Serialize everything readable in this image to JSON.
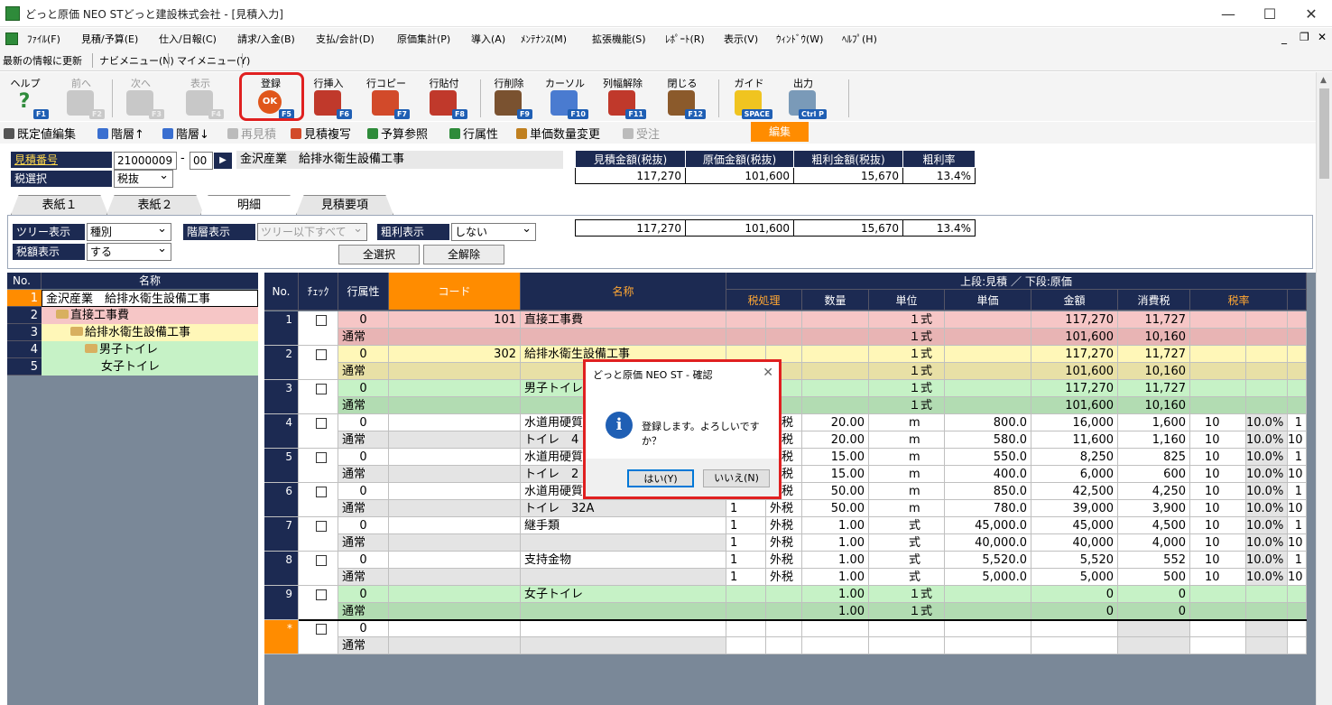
{
  "window": {
    "title": "どっと原価 NEO STどっと建設株式会社 - [見積入力]"
  },
  "menu": [
    "ﾌｧｲﾙ(F)",
    "見積/予算(E)",
    "仕入/日報(C)",
    "請求/入金(B)",
    "支払/会計(D)",
    "原価集計(P)",
    "導入(A)",
    "ﾒﾝﾃﾅﾝｽ(M)",
    "拡張機能(S)",
    "ﾚﾎﾟｰﾄ(R)",
    "表示(V)",
    "ｳｨﾝﾄﾞｳ(W)",
    "ﾍﾙﾌﾟ(H)"
  ],
  "quick": [
    "最新の情報に更新",
    "ナビメニュー(N)",
    "マイメニュー(Y)"
  ],
  "toolbar": [
    {
      "label": "ヘルプ",
      "key": "F1"
    },
    {
      "label": "前へ",
      "key": "F2"
    },
    {
      "label": "次へ",
      "key": "F3"
    },
    {
      "label": "表示",
      "key": "F4"
    },
    {
      "label": "登録",
      "key": "F5"
    },
    {
      "label": "行挿入",
      "key": "F6"
    },
    {
      "label": "行コピー",
      "key": "F7"
    },
    {
      "label": "行貼付",
      "key": "F8"
    },
    {
      "label": "行削除",
      "key": "F9"
    },
    {
      "label": "カーソル",
      "key": "F10"
    },
    {
      "label": "列幅解除",
      "key": "F11"
    },
    {
      "label": "閉じる",
      "key": "F12"
    },
    {
      "label": "ガイド",
      "key": "SPACE"
    },
    {
      "label": "出力",
      "key": "Ctrl P"
    }
  ],
  "subtools": [
    "既定値編集",
    "階層↑",
    "階層↓",
    "再見積",
    "見積複写",
    "予算参照",
    "行属性",
    "単価数量変更",
    "受注"
  ],
  "edit_label": "編集",
  "header": {
    "estimate_no_label": "見積番号",
    "estimate_no": "21000009",
    "estimate_sub": "00",
    "estimate_name": "金沢産業　給排水衛生設備工事",
    "tax_label": "税選択",
    "tax_value": "税抜"
  },
  "summary": {
    "headers": [
      "見積金額(税抜)",
      "原価金額(税抜)",
      "粗利金額(税抜)",
      "粗利率"
    ],
    "values": [
      "117,270",
      "101,600",
      "15,670",
      "13.4%"
    ],
    "values2": [
      "117,270",
      "101,600",
      "15,670",
      "13.4%"
    ]
  },
  "tabs": [
    "表紙１",
    "表紙２",
    "明細",
    "見積要項"
  ],
  "filters": {
    "tree_label": "ツリー表示",
    "tree_value": "種別",
    "tax_label": "税額表示",
    "tax_value": "する",
    "level_label": "階層表示",
    "level_value": "ツリー以下すべて",
    "profit_label": "粗利表示",
    "profit_value": "しない",
    "select_all": "全選択",
    "deselect_all": "全解除"
  },
  "tree": {
    "header_no": "No.",
    "header_name": "名称",
    "rows": [
      {
        "no": "1",
        "name": "金沢産業　給排水衛生設備工事",
        "bg": "#ffffff"
      },
      {
        "no": "2",
        "name": "直接工事費",
        "bg": "#f6c6c6"
      },
      {
        "no": "3",
        "name": "給排水衛生設備工事",
        "bg": "#fff7b8"
      },
      {
        "no": "4",
        "name": "男子トイレ",
        "bg": "#c6f2c6"
      },
      {
        "no": "5",
        "name": "女子トイレ",
        "bg": "#c6f2c6"
      }
    ]
  },
  "grid": {
    "headers": {
      "no": "No.",
      "check": "ﾁｪｯｸ",
      "attr": "行属性",
      "code": "コード",
      "name": "名称",
      "top": "上段:見積 ／ 下段:原価",
      "taxproc": "税処理",
      "qty": "数量",
      "unit": "単位",
      "price": "単価",
      "amount": "金額",
      "tax": "消費税",
      "taxrate": "税率"
    },
    "rows": [
      {
        "no": "1",
        "attr": "0",
        "type": "通常",
        "code": "101",
        "n1": "直接工事費",
        "n2": "",
        "tp1": "",
        "tp2": "",
        "tp3": "",
        "tp4": "",
        "q1": "",
        "q2": "",
        "u1": "１式",
        "u2": "１式",
        "p1": "",
        "p2": "",
        "a1": "117,270",
        "a2": "101,600",
        "t1": "11,727",
        "t2": "10,160",
        "r1": "",
        "r2": "",
        "rr1": "",
        "rr2": "",
        "x1": "",
        "x2": "",
        "bg": "#f6c6c6",
        "bg2": "#e8b4b4"
      },
      {
        "no": "2",
        "attr": "0",
        "type": "通常",
        "code": "302",
        "n1": "給排水衛生設備工事",
        "n2": "",
        "tp1": "",
        "tp2": "",
        "tp3": "",
        "tp4": "",
        "q1": "",
        "q2": "",
        "u1": "１式",
        "u2": "１式",
        "p1": "",
        "p2": "",
        "a1": "117,270",
        "a2": "101,600",
        "t1": "11,727",
        "t2": "10,160",
        "r1": "",
        "r2": "",
        "rr1": "",
        "rr2": "",
        "x1": "",
        "x2": "",
        "bg": "#fff7b8",
        "bg2": "#e8e0a6"
      },
      {
        "no": "3",
        "attr": "0",
        "type": "通常",
        "code": "",
        "n1": "男子トイレ",
        "n2": "",
        "tp1": "",
        "tp2": "",
        "tp3": "",
        "tp4": "",
        "q1": "",
        "q2": "",
        "u1": "１式",
        "u2": "１式",
        "p1": "",
        "p2": "",
        "a1": "117,270",
        "a2": "101,600",
        "t1": "11,727",
        "t2": "10,160",
        "r1": "",
        "r2": "",
        "rr1": "",
        "rr2": "",
        "x1": "",
        "x2": "",
        "bg": "#c6f2c6",
        "bg2": "#b2dcb2"
      },
      {
        "no": "4",
        "attr": "0",
        "type": "通常",
        "code": "",
        "n1": "水道用硬質",
        "n2": "トイレ　4",
        "tp1": "1",
        "tp2": "外税",
        "tp3": "1",
        "tp4": "外税",
        "q1": "20.00",
        "q2": "20.00",
        "u1": "m",
        "u2": "m",
        "p1": "800.0",
        "p2": "580.0",
        "a1": "16,000",
        "a2": "11,600",
        "t1": "1,600",
        "t2": "1,160",
        "r1": "10",
        "r2": "10",
        "rr1": "10.0%",
        "rr2": "10.0%",
        "x1": "1",
        "x2": "10",
        "bg": "#ffffff",
        "bg2": "#ffffff"
      },
      {
        "no": "5",
        "attr": "0",
        "type": "通常",
        "code": "",
        "n1": "水道用硬質",
        "n2": "トイレ　2",
        "tp1": "1",
        "tp2": "外税",
        "tp3": "1",
        "tp4": "外税",
        "q1": "15.00",
        "q2": "15.00",
        "u1": "m",
        "u2": "m",
        "p1": "550.0",
        "p2": "400.0",
        "a1": "8,250",
        "a2": "6,000",
        "t1": "825",
        "t2": "600",
        "r1": "10",
        "r2": "10",
        "rr1": "10.0%",
        "rr2": "10.0%",
        "x1": "1",
        "x2": "10",
        "bg": "#ffffff",
        "bg2": "#ffffff"
      },
      {
        "no": "6",
        "attr": "0",
        "type": "通常",
        "code": "",
        "n1": "水道用硬質",
        "n2": "トイレ　32A",
        "tp1": "1",
        "tp2": "外税",
        "tp3": "1",
        "tp4": "外税",
        "q1": "50.00",
        "q2": "50.00",
        "u1": "m",
        "u2": "m",
        "p1": "850.0",
        "p2": "780.0",
        "a1": "42,500",
        "a2": "39,000",
        "t1": "4,250",
        "t2": "3,900",
        "r1": "10",
        "r2": "10",
        "rr1": "10.0%",
        "rr2": "10.0%",
        "x1": "1",
        "x2": "10",
        "bg": "#ffffff",
        "bg2": "#ffffff"
      },
      {
        "no": "7",
        "attr": "0",
        "type": "通常",
        "code": "",
        "n1": "継手類",
        "n2": "",
        "tp1": "1",
        "tp2": "外税",
        "tp3": "1",
        "tp4": "外税",
        "q1": "1.00",
        "q2": "1.00",
        "u1": "式",
        "u2": "式",
        "p1": "45,000.0",
        "p2": "40,000.0",
        "a1": "45,000",
        "a2": "40,000",
        "t1": "4,500",
        "t2": "4,000",
        "r1": "10",
        "r2": "10",
        "rr1": "10.0%",
        "rr2": "10.0%",
        "x1": "1",
        "x2": "10",
        "bg": "#ffffff",
        "bg2": "#ffffff"
      },
      {
        "no": "8",
        "attr": "0",
        "type": "通常",
        "code": "",
        "n1": "支持金物",
        "n2": "",
        "tp1": "1",
        "tp2": "外税",
        "tp3": "1",
        "tp4": "外税",
        "q1": "1.00",
        "q2": "1.00",
        "u1": "式",
        "u2": "式",
        "p1": "5,520.0",
        "p2": "5,000.0",
        "a1": "5,520",
        "a2": "5,000",
        "t1": "552",
        "t2": "500",
        "r1": "10",
        "r2": "10",
        "rr1": "10.0%",
        "rr2": "10.0%",
        "x1": "1",
        "x2": "10",
        "bg": "#ffffff",
        "bg2": "#ffffff"
      },
      {
        "no": "9",
        "attr": "0",
        "type": "通常",
        "code": "",
        "n1": "女子トイレ",
        "n2": "",
        "tp1": "",
        "tp2": "",
        "tp3": "",
        "tp4": "",
        "q1": "1.00",
        "q2": "1.00",
        "u1": "１式",
        "u2": "１式",
        "p1": "",
        "p2": "",
        "a1": "0",
        "a2": "0",
        "t1": "0",
        "t2": "0",
        "r1": "",
        "r2": "",
        "rr1": "",
        "rr2": "",
        "x1": "",
        "x2": "",
        "bg": "#c6f2c6",
        "bg2": "#b2dcb2"
      },
      {
        "no": "*",
        "attr": "0",
        "type": "通常",
        "code": "",
        "n1": "",
        "n2": "",
        "tp1": "",
        "tp2": "",
        "tp3": "",
        "tp4": "",
        "q1": "",
        "q2": "",
        "u1": "",
        "u2": "",
        "p1": "",
        "p2": "",
        "a1": "",
        "a2": "",
        "t1": "",
        "t2": "",
        "r1": "",
        "r2": "",
        "rr1": "",
        "rr2": "",
        "x1": "",
        "x2": "",
        "bg": "#ffffff",
        "bg2": "#ffffff",
        "newrow": true
      }
    ]
  },
  "dialog": {
    "title": "どっと原価 NEO ST - 確認",
    "message": "登録します。よろしいですか？",
    "yes": "はい(Y)",
    "no": "いいえ(N)"
  }
}
